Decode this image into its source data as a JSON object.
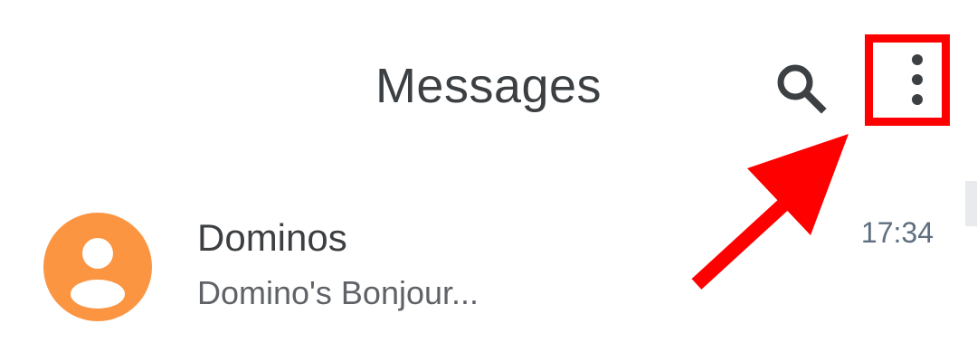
{
  "header": {
    "title": "Messages",
    "search_icon": "search-icon",
    "more_icon": "more-vert-icon"
  },
  "conversations": [
    {
      "name": "Dominos",
      "snippet": "Domino's Bonjour...",
      "time": "17:34",
      "avatar_icon": "person-icon",
      "avatar_color": "#fb9542"
    }
  ],
  "annotation": {
    "highlight_color": "#ff0000",
    "target": "more-options-button"
  }
}
